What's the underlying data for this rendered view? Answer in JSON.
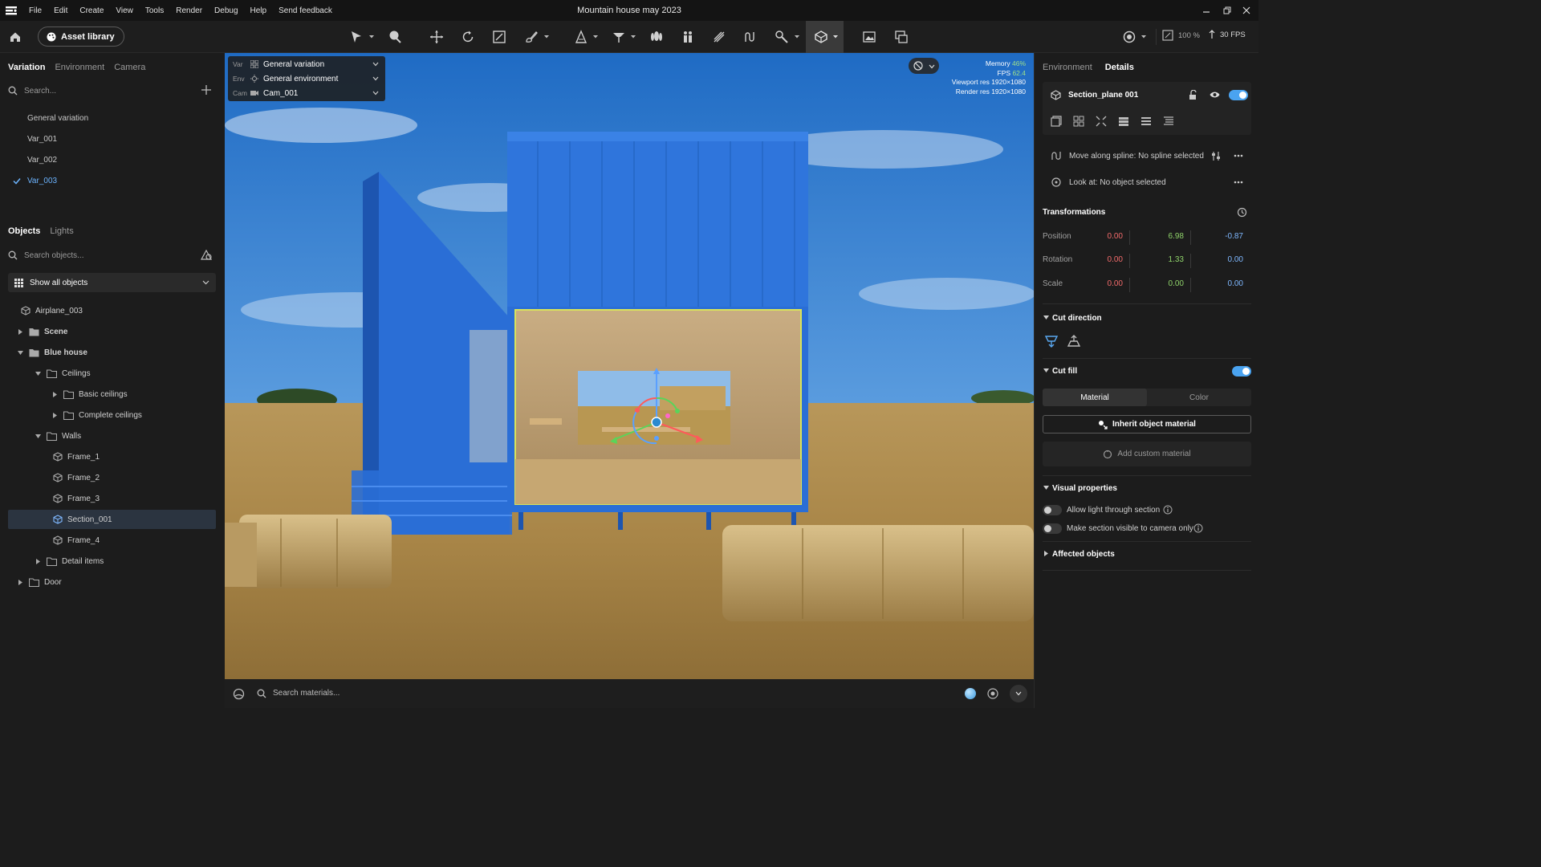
{
  "window": {
    "title": "Mountain house may 2023",
    "menu": [
      "File",
      "Edit",
      "Create",
      "View",
      "Tools",
      "Render",
      "Debug",
      "Help",
      "Send feedback"
    ]
  },
  "toolbar": {
    "asset_library_label": "Asset library",
    "zoom_label": "100 %",
    "fps_label": "30 FPS"
  },
  "left": {
    "top_tabs": [
      "Variation",
      "Environment",
      "Camera"
    ],
    "variation_search_placeholder": "Search...",
    "variations": [
      "General variation",
      "Var_001",
      "Var_002",
      "Var_003"
    ],
    "selected_variation": "Var_003",
    "object_tabs": [
      "Objects",
      "Lights"
    ],
    "object_search_placeholder": "Search objects...",
    "filter_label": "Show all objects",
    "tree": [
      {
        "label": "Airplane_003",
        "icon": "cube-icon"
      },
      {
        "label": "Scene",
        "icon": "folder-icon"
      },
      {
        "label": "Blue house",
        "icon": "folder-icon"
      },
      {
        "label": "Ceilings",
        "icon": "folder-outline-icon"
      },
      {
        "label": "Basic ceilings",
        "icon": "folder-outline-icon"
      },
      {
        "label": "Complete ceilings",
        "icon": "folder-outline-icon"
      },
      {
        "label": "Walls",
        "icon": "folder-outline-icon"
      },
      {
        "label": "Frame_1",
        "icon": "cube-icon"
      },
      {
        "label": "Frame_2",
        "icon": "cube-icon"
      },
      {
        "label": "Frame_3",
        "icon": "cube-icon"
      },
      {
        "label": "Section_001",
        "icon": "section-plane-icon"
      },
      {
        "label": "Frame_4",
        "icon": "cube-icon"
      },
      {
        "label": "Detail items",
        "icon": "folder-outline-icon"
      },
      {
        "label": "Door",
        "icon": "folder-outline-icon"
      }
    ]
  },
  "viewport": {
    "var_rows": [
      {
        "key": "Var",
        "value": "General variation"
      },
      {
        "key": "Env",
        "value": "General environment"
      },
      {
        "key": "Cam",
        "value": "Cam_001"
      }
    ],
    "stats": [
      {
        "label": "Memory",
        "value": "46%"
      },
      {
        "label": "FPS",
        "value": "62.4"
      },
      {
        "label": "Viewport res",
        "value": "1920×1080"
      },
      {
        "label": "Render res",
        "value": "1920×1080"
      }
    ]
  },
  "bottombar": {
    "search_placeholder": "Search materials..."
  },
  "right": {
    "tabs": [
      "Environment",
      "Details"
    ],
    "object_name": "Section_plane 001",
    "spline_label": "Move along spline: No spline selected",
    "lookat_label": "Look at: No object selected",
    "transform_title": "Transformations",
    "transforms": [
      {
        "label": "Position",
        "x": "0.00",
        "y": "6.98",
        "z": "-0.87"
      },
      {
        "label": "Rotation",
        "x": "0.00",
        "y": "1.33",
        "z": "0.00"
      },
      {
        "label": "Scale",
        "x": "0.00",
        "y": "0.00",
        "z": "0.00"
      }
    ],
    "cut_direction_title": "Cut direction",
    "cut_fill_title": "Cut fill",
    "cut_fill_enabled": true,
    "fill_tabs": [
      "Material",
      "Color"
    ],
    "inherit_label": "Inherit object material",
    "custom_label": "Add custom material",
    "visual_title": "Visual properties",
    "visual_options": [
      {
        "label": "Allow light through section",
        "enabled": false
      },
      {
        "label": "Make section visible to camera only",
        "enabled": false
      }
    ],
    "affected_title": "Affected objects"
  },
  "colors": {
    "accent": "#4aa3f0",
    "x_axis": "#f26b6b",
    "y_axis": "#8fd36a",
    "z_axis": "#7fb8ff"
  }
}
